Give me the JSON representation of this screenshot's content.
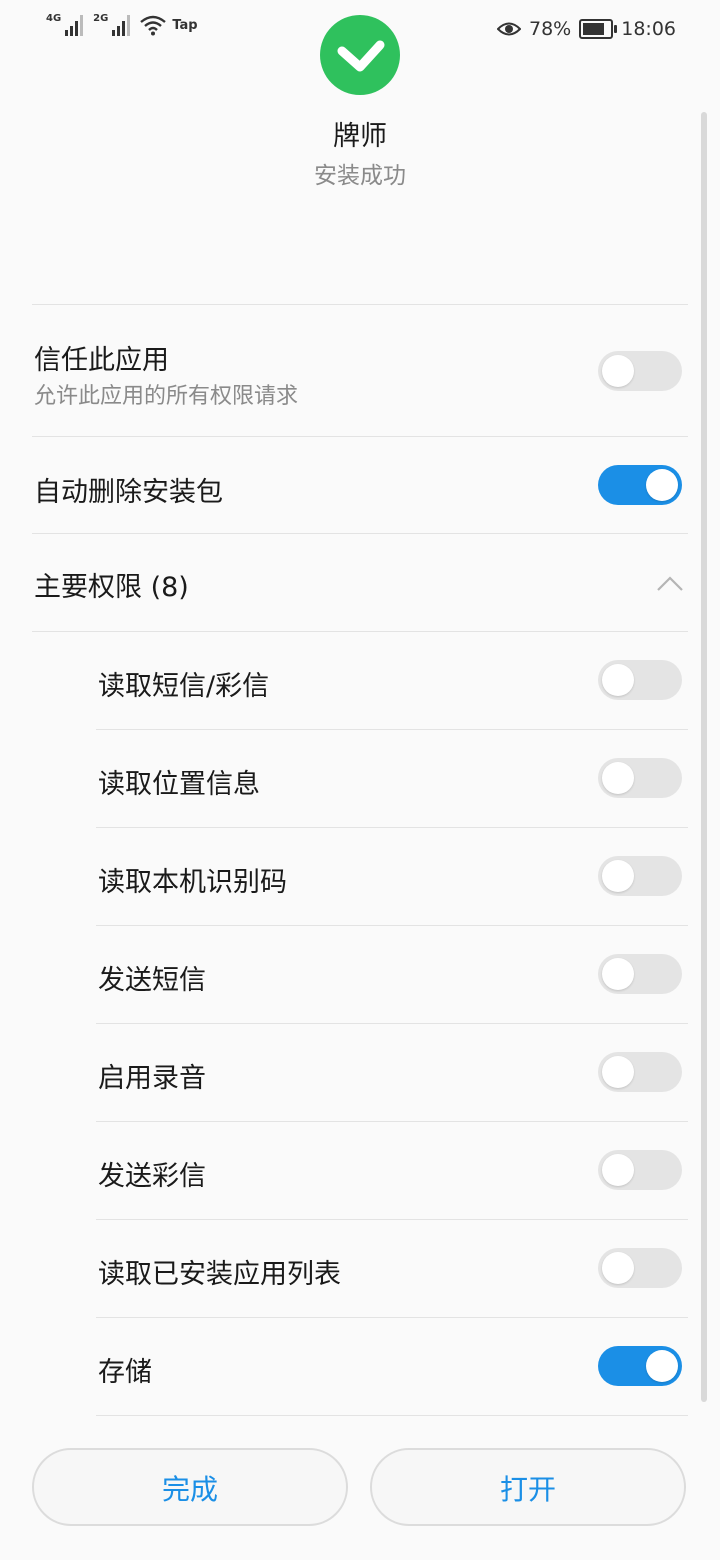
{
  "status_bar": {
    "signal1_label": "4G",
    "signal2_label": "2G",
    "tap_label": "Tap",
    "battery_percent": "78%",
    "battery_level": 0.78,
    "time": "18:06",
    "icons": [
      "signal-icon",
      "wifi-icon",
      "eye-comfort-icon",
      "battery-icon"
    ]
  },
  "header": {
    "app_name": "牌师",
    "install_status": "安装成功",
    "success_color": "#2fc15d"
  },
  "settings": {
    "trust": {
      "title": "信任此应用",
      "subtitle": "允许此应用的所有权限请求",
      "enabled": false
    },
    "auto_delete": {
      "title": "自动删除安装包",
      "enabled": true
    },
    "permissions_header": "主要权限 (8)"
  },
  "permissions": [
    {
      "label": "读取短信/彩信",
      "enabled": false
    },
    {
      "label": "读取位置信息",
      "enabled": false
    },
    {
      "label": "读取本机识别码",
      "enabled": false
    },
    {
      "label": "发送短信",
      "enabled": false
    },
    {
      "label": "启用录音",
      "enabled": false
    },
    {
      "label": "发送彩信",
      "enabled": false
    },
    {
      "label": "读取已安装应用列表",
      "enabled": false
    },
    {
      "label": "存储",
      "enabled": true
    }
  ],
  "buttons": {
    "done": "完成",
    "open": "打开"
  },
  "colors": {
    "accent": "#1b8fe6",
    "toggle_off": "#e4e4e4"
  }
}
